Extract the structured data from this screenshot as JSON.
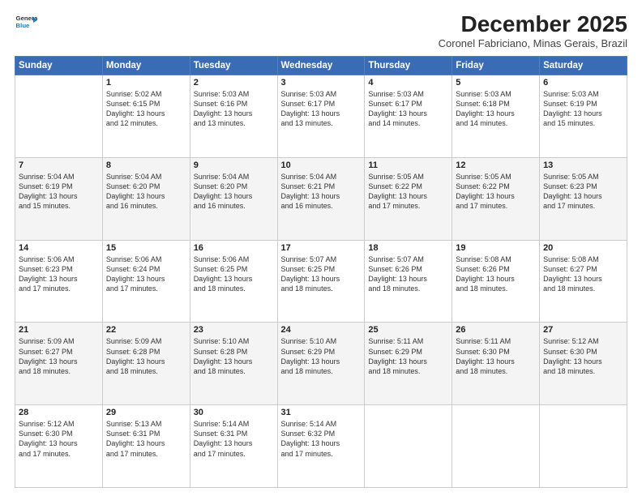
{
  "logo": {
    "line1": "General",
    "line2": "Blue"
  },
  "title": "December 2025",
  "subtitle": "Coronel Fabriciano, Minas Gerais, Brazil",
  "days_header": [
    "Sunday",
    "Monday",
    "Tuesday",
    "Wednesday",
    "Thursday",
    "Friday",
    "Saturday"
  ],
  "weeks": [
    [
      {
        "day": "",
        "info": ""
      },
      {
        "day": "1",
        "info": "Sunrise: 5:02 AM\nSunset: 6:15 PM\nDaylight: 13 hours\nand 12 minutes."
      },
      {
        "day": "2",
        "info": "Sunrise: 5:03 AM\nSunset: 6:16 PM\nDaylight: 13 hours\nand 13 minutes."
      },
      {
        "day": "3",
        "info": "Sunrise: 5:03 AM\nSunset: 6:17 PM\nDaylight: 13 hours\nand 13 minutes."
      },
      {
        "day": "4",
        "info": "Sunrise: 5:03 AM\nSunset: 6:17 PM\nDaylight: 13 hours\nand 14 minutes."
      },
      {
        "day": "5",
        "info": "Sunrise: 5:03 AM\nSunset: 6:18 PM\nDaylight: 13 hours\nand 14 minutes."
      },
      {
        "day": "6",
        "info": "Sunrise: 5:03 AM\nSunset: 6:19 PM\nDaylight: 13 hours\nand 15 minutes."
      }
    ],
    [
      {
        "day": "7",
        "info": "Sunrise: 5:04 AM\nSunset: 6:19 PM\nDaylight: 13 hours\nand 15 minutes."
      },
      {
        "day": "8",
        "info": "Sunrise: 5:04 AM\nSunset: 6:20 PM\nDaylight: 13 hours\nand 16 minutes."
      },
      {
        "day": "9",
        "info": "Sunrise: 5:04 AM\nSunset: 6:20 PM\nDaylight: 13 hours\nand 16 minutes."
      },
      {
        "day": "10",
        "info": "Sunrise: 5:04 AM\nSunset: 6:21 PM\nDaylight: 13 hours\nand 16 minutes."
      },
      {
        "day": "11",
        "info": "Sunrise: 5:05 AM\nSunset: 6:22 PM\nDaylight: 13 hours\nand 17 minutes."
      },
      {
        "day": "12",
        "info": "Sunrise: 5:05 AM\nSunset: 6:22 PM\nDaylight: 13 hours\nand 17 minutes."
      },
      {
        "day": "13",
        "info": "Sunrise: 5:05 AM\nSunset: 6:23 PM\nDaylight: 13 hours\nand 17 minutes."
      }
    ],
    [
      {
        "day": "14",
        "info": "Sunrise: 5:06 AM\nSunset: 6:23 PM\nDaylight: 13 hours\nand 17 minutes."
      },
      {
        "day": "15",
        "info": "Sunrise: 5:06 AM\nSunset: 6:24 PM\nDaylight: 13 hours\nand 17 minutes."
      },
      {
        "day": "16",
        "info": "Sunrise: 5:06 AM\nSunset: 6:25 PM\nDaylight: 13 hours\nand 18 minutes."
      },
      {
        "day": "17",
        "info": "Sunrise: 5:07 AM\nSunset: 6:25 PM\nDaylight: 13 hours\nand 18 minutes."
      },
      {
        "day": "18",
        "info": "Sunrise: 5:07 AM\nSunset: 6:26 PM\nDaylight: 13 hours\nand 18 minutes."
      },
      {
        "day": "19",
        "info": "Sunrise: 5:08 AM\nSunset: 6:26 PM\nDaylight: 13 hours\nand 18 minutes."
      },
      {
        "day": "20",
        "info": "Sunrise: 5:08 AM\nSunset: 6:27 PM\nDaylight: 13 hours\nand 18 minutes."
      }
    ],
    [
      {
        "day": "21",
        "info": "Sunrise: 5:09 AM\nSunset: 6:27 PM\nDaylight: 13 hours\nand 18 minutes."
      },
      {
        "day": "22",
        "info": "Sunrise: 5:09 AM\nSunset: 6:28 PM\nDaylight: 13 hours\nand 18 minutes."
      },
      {
        "day": "23",
        "info": "Sunrise: 5:10 AM\nSunset: 6:28 PM\nDaylight: 13 hours\nand 18 minutes."
      },
      {
        "day": "24",
        "info": "Sunrise: 5:10 AM\nSunset: 6:29 PM\nDaylight: 13 hours\nand 18 minutes."
      },
      {
        "day": "25",
        "info": "Sunrise: 5:11 AM\nSunset: 6:29 PM\nDaylight: 13 hours\nand 18 minutes."
      },
      {
        "day": "26",
        "info": "Sunrise: 5:11 AM\nSunset: 6:30 PM\nDaylight: 13 hours\nand 18 minutes."
      },
      {
        "day": "27",
        "info": "Sunrise: 5:12 AM\nSunset: 6:30 PM\nDaylight: 13 hours\nand 18 minutes."
      }
    ],
    [
      {
        "day": "28",
        "info": "Sunrise: 5:12 AM\nSunset: 6:30 PM\nDaylight: 13 hours\nand 17 minutes."
      },
      {
        "day": "29",
        "info": "Sunrise: 5:13 AM\nSunset: 6:31 PM\nDaylight: 13 hours\nand 17 minutes."
      },
      {
        "day": "30",
        "info": "Sunrise: 5:14 AM\nSunset: 6:31 PM\nDaylight: 13 hours\nand 17 minutes."
      },
      {
        "day": "31",
        "info": "Sunrise: 5:14 AM\nSunset: 6:32 PM\nDaylight: 13 hours\nand 17 minutes."
      },
      {
        "day": "",
        "info": ""
      },
      {
        "day": "",
        "info": ""
      },
      {
        "day": "",
        "info": ""
      }
    ]
  ]
}
